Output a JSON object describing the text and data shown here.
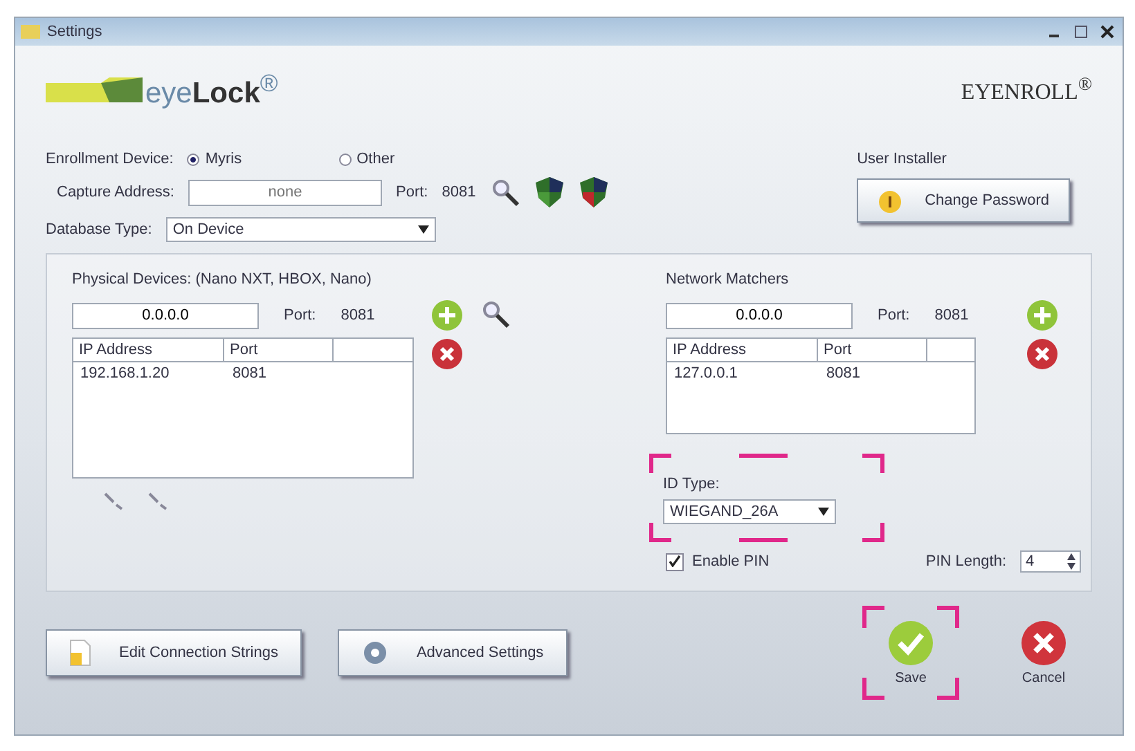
{
  "window": {
    "title": "Settings"
  },
  "logo": {
    "text": "eye**Lock**$^{®}$"
  },
  "product": "EYENROLL$^{®}$",
  "enrollment": {
    "label": "Enrollment Device:",
    "options": [
      {
        "label": "Myris",
        "selected": true
      },
      {
        "label": "Other",
        "selected": false
      }
    ]
  },
  "capture": {
    "label": "Capture Address:",
    "placeholder": "none",
    "port_label": "Port:",
    "port": "8081"
  },
  "user_installer": {
    "label": "User Installer",
    "button": "Change Password"
  },
  "database": {
    "label": "Database Type:",
    "value": "On Device"
  },
  "physical": {
    "title": "Physical Devices: (Nano NXT, HBOX, Nano)",
    "ip": "0.0.0.0",
    "port_label": "Port:",
    "port": "8081",
    "columns": [
      "IP Address",
      "Port"
    ],
    "rows": [
      [
        "192.168.1.20",
        "8081"
      ]
    ]
  },
  "network": {
    "title": "Network Matchers",
    "ip": "0.0.0.0",
    "port_label": "Port:",
    "port": "8081",
    "columns": [
      "IP Address",
      "Port"
    ],
    "rows": [
      [
        "127.0.0.1",
        "8081"
      ]
    ]
  },
  "id_type": {
    "label": "ID Type:",
    "value": "WIEGAND_26A",
    "highlighted": true
  },
  "pin": {
    "label": "Enable PIN",
    "checked": true,
    "length_label": "PIN Length:",
    "length": "4"
  },
  "buttons": [
    {
      "label": "Edit Connection Strings",
      "kind": "doc"
    },
    {
      "label": "Advanced Settings",
      "kind": "gear"
    }
  ],
  "actions": [
    {
      "label": "Save",
      "kind": "save",
      "highlighted": true
    },
    {
      "label": "Cancel",
      "kind": "cancel",
      "highlighted": false
    }
  ]
}
